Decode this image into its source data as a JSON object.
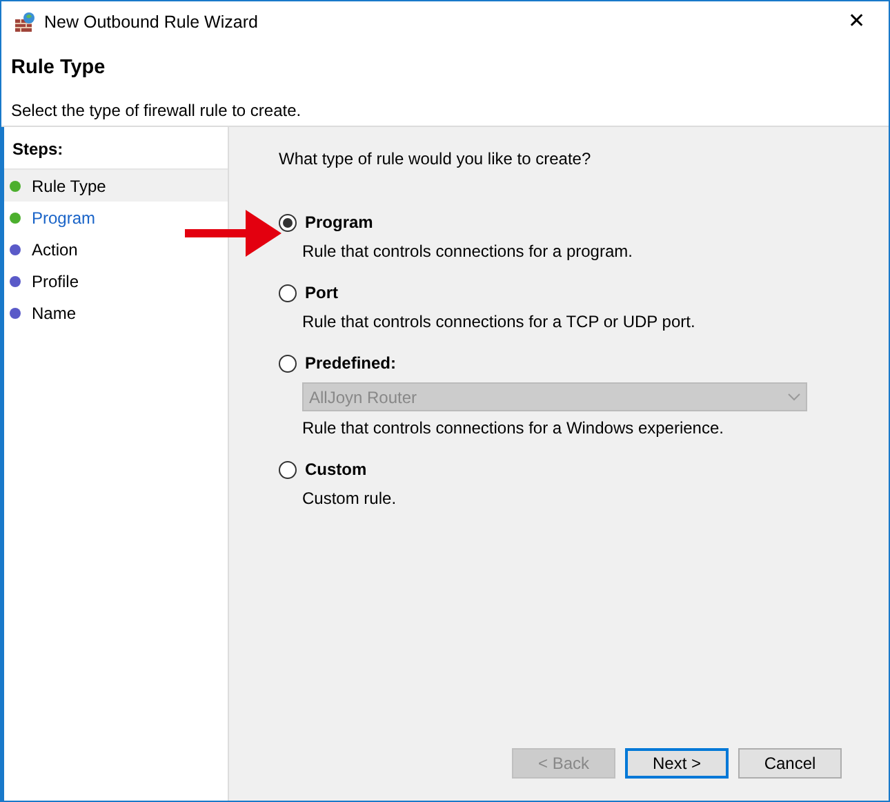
{
  "window": {
    "title": "New Outbound Rule Wizard",
    "close": "✕"
  },
  "header": {
    "title": "Rule Type",
    "subtitle": "Select the type of firewall rule to create."
  },
  "steps": {
    "heading": "Steps:",
    "items": [
      {
        "label": "Rule Type",
        "selected": true,
        "hovered": false,
        "color": "#4caf2e"
      },
      {
        "label": "Program",
        "selected": false,
        "hovered": true,
        "color": "#4caf2e"
      },
      {
        "label": "Action",
        "selected": false,
        "hovered": false,
        "color": "#5a5ac8"
      },
      {
        "label": "Profile",
        "selected": false,
        "hovered": false,
        "color": "#5a5ac8"
      },
      {
        "label": "Name",
        "selected": false,
        "hovered": false,
        "color": "#5a5ac8"
      }
    ]
  },
  "question": "What type of rule would you like to create?",
  "options": [
    {
      "label": "Program",
      "description": "Rule that controls connections for a program.",
      "selected": true
    },
    {
      "label": "Port",
      "description": "Rule that controls connections for a TCP or UDP port.",
      "selected": false
    },
    {
      "label": "Predefined:",
      "dropdown": {
        "value": "AllJoyn Router",
        "disabled": true
      },
      "description": "Rule that controls connections for a Windows experience.",
      "selected": false
    },
    {
      "label": "Custom",
      "description": "Custom rule.",
      "selected": false
    }
  ],
  "buttons": [
    {
      "label": "< Back",
      "disabled": true,
      "focused": false
    },
    {
      "label": "Next >",
      "disabled": false,
      "focused": true
    },
    {
      "label": "Cancel",
      "disabled": false,
      "focused": false
    }
  ]
}
